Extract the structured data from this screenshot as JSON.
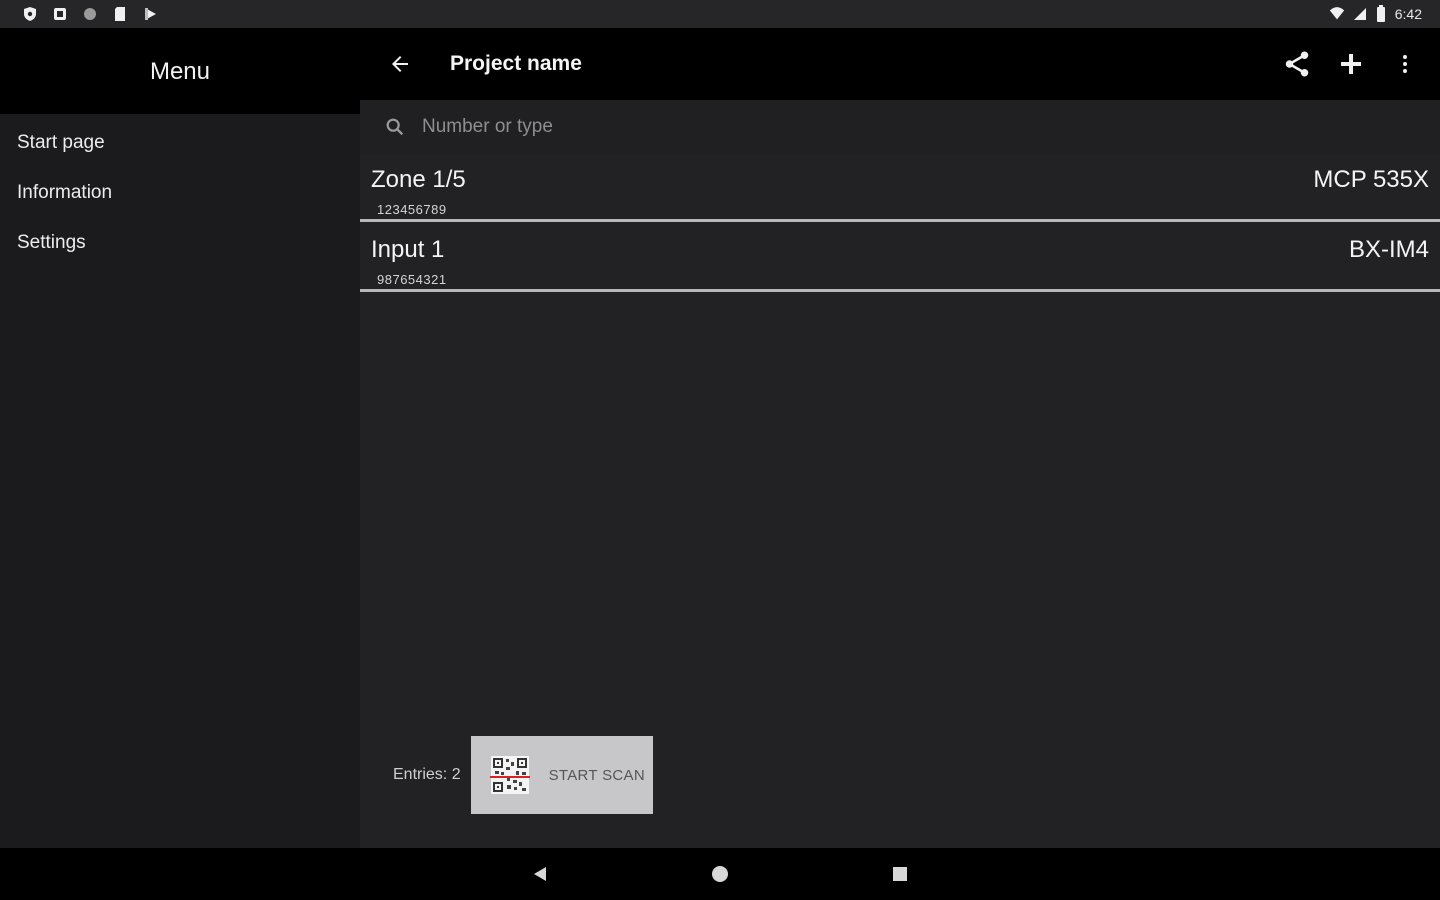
{
  "status_bar": {
    "left_icons": [
      "shield-icon",
      "notification-icon",
      "circle-icon",
      "sd-card-icon",
      "play-store-icon"
    ],
    "right_icons": [
      "wifi-icon",
      "signal-icon",
      "battery-icon"
    ],
    "time": "6:42"
  },
  "menu": {
    "header": "Menu",
    "items": [
      {
        "label": "Start page"
      },
      {
        "label": "Information"
      },
      {
        "label": "Settings"
      }
    ]
  },
  "appbar": {
    "title": "Project name",
    "actions": [
      "share-icon",
      "add-icon",
      "more-vert-icon"
    ]
  },
  "search": {
    "placeholder": "Number or type",
    "value": ""
  },
  "entries": [
    {
      "title": "Zone 1/5",
      "type": "MCP 535X",
      "number": "123456789"
    },
    {
      "title": "Input 1",
      "type": "BX-IM4",
      "number": "987654321"
    }
  ],
  "footer": {
    "entries_label": "Entries: 2",
    "scan_label": "START SCAN"
  },
  "navbar": {
    "buttons": [
      "back-triangle-icon",
      "home-circle-icon",
      "recents-square-icon"
    ]
  },
  "colors": {
    "background": "#222225",
    "menu_background": "#1b1b1d",
    "bar_background": "#000000",
    "divider": "#b9b9b9",
    "scan_button": "#c7c7c9"
  }
}
